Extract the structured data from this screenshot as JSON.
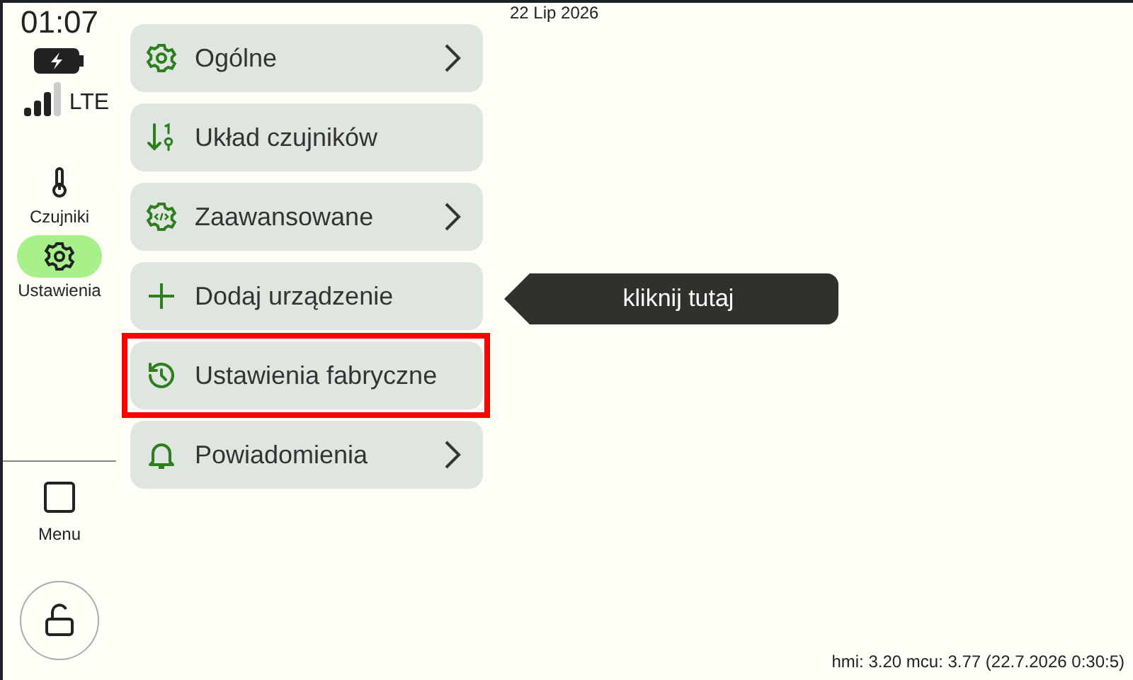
{
  "status": {
    "time": "01:07",
    "network": "LTE"
  },
  "nav": [
    {
      "label": "Czujniki",
      "kind": "thermometer",
      "selected": false
    },
    {
      "label": "Ustawienia",
      "kind": "gear",
      "selected": true
    }
  ],
  "bottom_nav": {
    "label": "Menu"
  },
  "date": "22 Lip 2026",
  "menu": [
    {
      "label": "Ogólne",
      "kind": "gear",
      "chevron": true,
      "highlighted": false
    },
    {
      "label": "Układ czujników",
      "kind": "sort",
      "chevron": false,
      "highlighted": false
    },
    {
      "label": "Zaawansowane",
      "kind": "code-gear",
      "chevron": true,
      "highlighted": false
    },
    {
      "label": "Dodaj urządzenie",
      "kind": "plus",
      "chevron": false,
      "highlighted": false,
      "tooltip": "kliknij tutaj"
    },
    {
      "label": "Ustawienia fabryczne",
      "kind": "history",
      "chevron": false,
      "highlighted": true
    },
    {
      "label": "Powiadomienia",
      "kind": "bell",
      "chevron": true,
      "highlighted": false
    }
  ],
  "version": "hmi: 3.20 mcu: 3.77 (22.7.2026 0:30:5)"
}
